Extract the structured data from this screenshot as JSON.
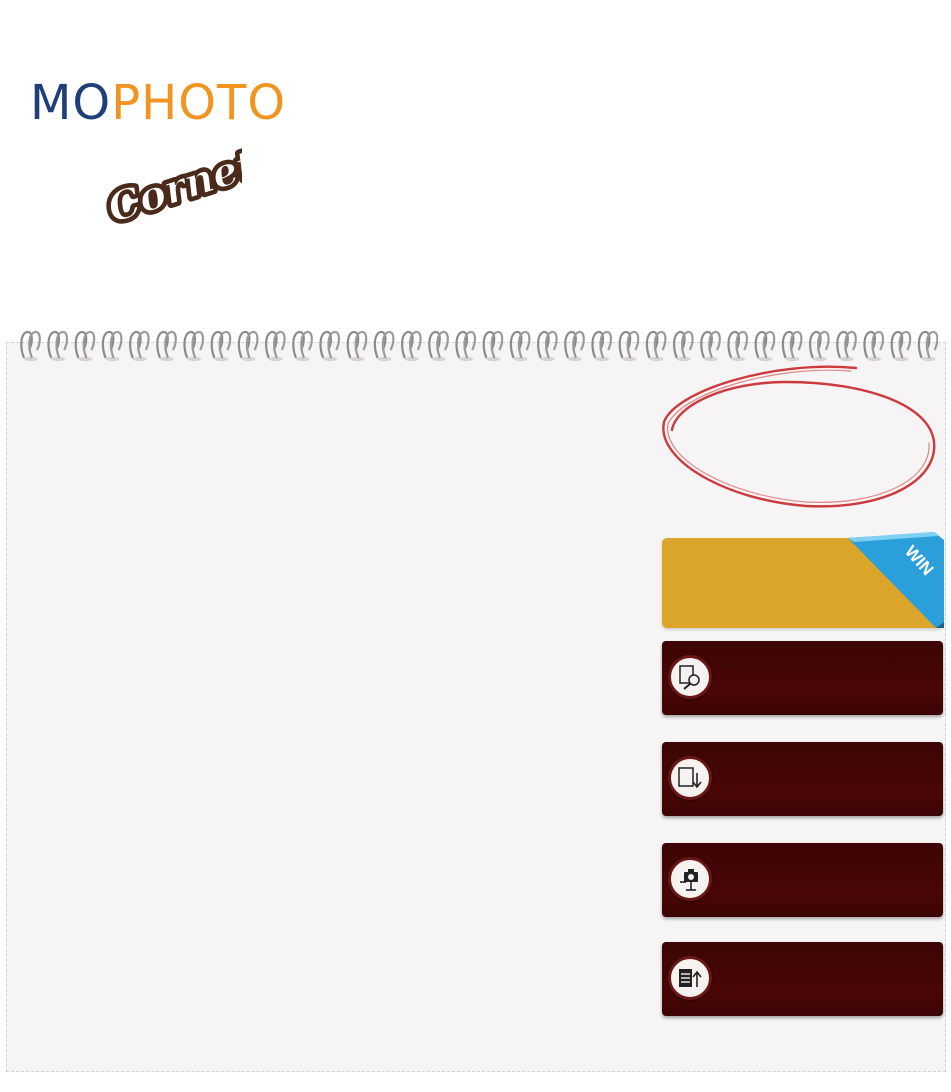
{
  "header": {
    "logo_part1": "MO",
    "logo_part2": "PHOTO",
    "brand_logo": "Cornetto"
  },
  "colors": {
    "logo_blue": "#1f3f7a",
    "logo_orange": "#f29421",
    "win_card": "#daa52a",
    "menu_button": "#440606",
    "circle_marker": "#c8262a",
    "ribbon_blue": "#2b9fd9"
  },
  "win_badge": {
    "label": "WIN"
  },
  "menu": {
    "items": [
      {
        "icon": "browse-search-icon",
        "label": ""
      },
      {
        "icon": "download-icon",
        "label": ""
      },
      {
        "icon": "camera-icon",
        "label": ""
      },
      {
        "icon": "upload-list-icon",
        "label": ""
      }
    ]
  }
}
